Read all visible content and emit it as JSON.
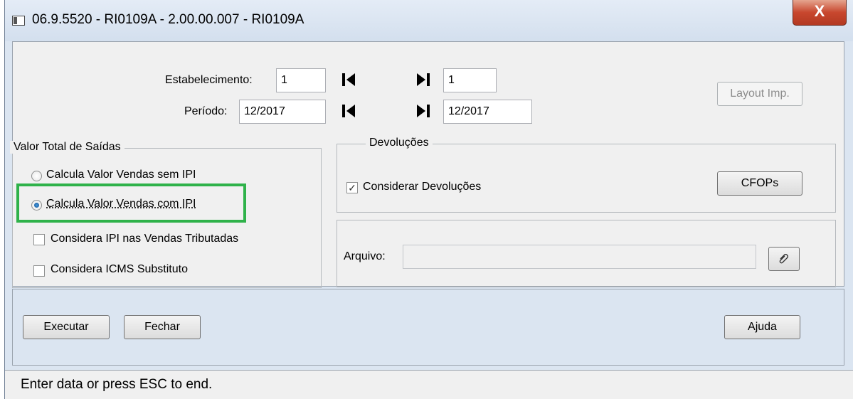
{
  "window": {
    "title": "06.9.5520 - RI0109A - 2.00.00.007 - RI0109A",
    "close_label": "X"
  },
  "params": {
    "estabelecimento_label": "Estabelecimento:",
    "estabelecimento_from": "1",
    "estabelecimento_to": "1",
    "periodo_label": "Período:",
    "periodo_from": "12/2017",
    "periodo_to": "12/2017",
    "layout_button": "Layout Imp."
  },
  "valor_total": {
    "legend": "Valor Total de Saídas",
    "radio_sem_ipi": "Calcula Valor Vendas sem IPI",
    "radio_com_ipi": "Calcula Valor Vendas com IPI",
    "selected": "com_ipi",
    "check_ipi_tributadas": "Considera IPI nas Vendas Tributadas",
    "check_icms": "Considera ICMS Substituto"
  },
  "devolucoes": {
    "legend": "Devoluções",
    "check_label": "Considerar Devoluções",
    "checked": true,
    "cfops_button": "CFOPs"
  },
  "arquivo": {
    "label": "Arquivo:",
    "value": ""
  },
  "actions": {
    "executar": "Executar",
    "fechar": "Fechar",
    "ajuda": "Ajuda"
  },
  "status": {
    "text": "Enter data or press ESC to end."
  },
  "colors": {
    "highlight": "#2fb24a",
    "window_frame": "#dbe5f1",
    "close_button": "#c8472e"
  }
}
